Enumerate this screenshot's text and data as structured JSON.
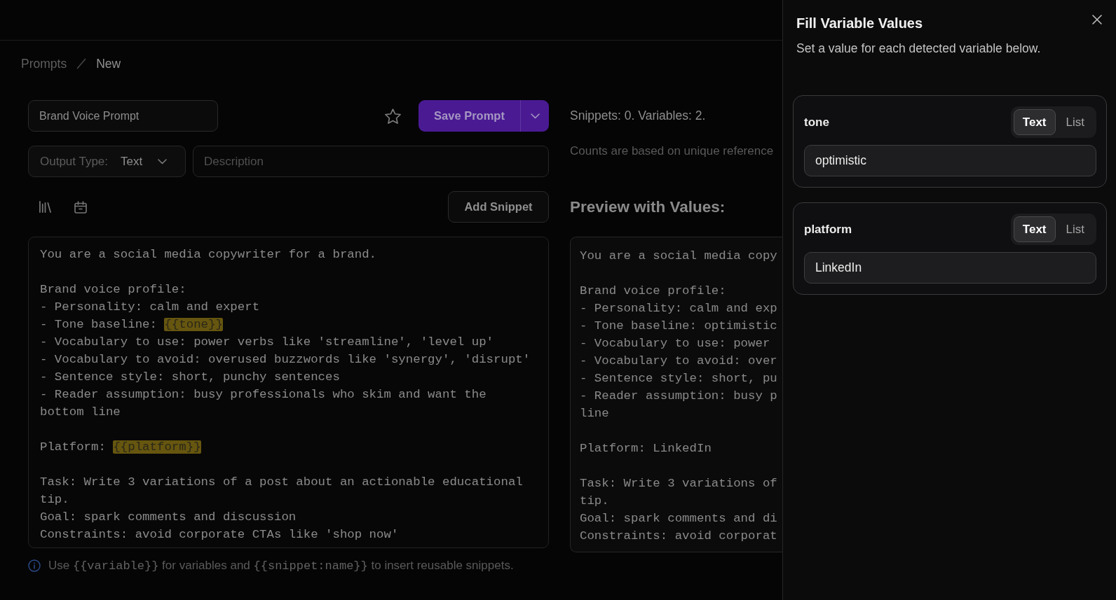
{
  "breadcrumb": [
    {
      "label": "Prompts",
      "current": false
    },
    {
      "label": "New",
      "current": true
    }
  ],
  "title_input": {
    "value": "Brand Voice Prompt"
  },
  "save_button": {
    "label": "Save Prompt"
  },
  "stats": "Snippets: 0. Variables: 2.",
  "output_type": {
    "label": "Output Type:",
    "value": "Text"
  },
  "description": {
    "placeholder": "Description"
  },
  "counts_note": "Counts are based on unique reference",
  "add_snippet_button": {
    "label": "Add Snippet"
  },
  "preview_heading": "Preview with Values:",
  "editor": {
    "paragraphs": [
      {
        "lines": [
          {
            "parts": [
              {
                "kind": "text",
                "text": "You are a social media copywriter for a brand."
              }
            ]
          }
        ]
      },
      {
        "lines": [
          {
            "parts": [
              {
                "kind": "text",
                "text": "Brand voice profile:"
              }
            ]
          },
          {
            "parts": [
              {
                "kind": "text",
                "text": "- Personality: calm and expert"
              }
            ]
          },
          {
            "parts": [
              {
                "kind": "text",
                "text": "- Tone baseline: "
              },
              {
                "kind": "variable",
                "text": "{{tone}}"
              }
            ]
          },
          {
            "parts": [
              {
                "kind": "text",
                "text": "- Vocabulary to use: power verbs like 'streamline', 'level up'"
              }
            ]
          },
          {
            "parts": [
              {
                "kind": "text",
                "text": "- Vocabulary to avoid: overused buzzwords like 'synergy', 'disrupt'"
              }
            ]
          },
          {
            "parts": [
              {
                "kind": "text",
                "text": "- Sentence style: short, punchy sentences"
              }
            ]
          },
          {
            "parts": [
              {
                "kind": "text",
                "text": "- Reader assumption: busy professionals who skim and want the bottom line"
              }
            ]
          }
        ]
      },
      {
        "lines": [
          {
            "parts": [
              {
                "kind": "text",
                "text": "Platform: "
              },
              {
                "kind": "variable",
                "text": "{{platform}}"
              }
            ]
          }
        ]
      },
      {
        "lines": [
          {
            "parts": [
              {
                "kind": "text",
                "text": "Task: Write 3 variations of a post about an actionable educational tip."
              }
            ]
          },
          {
            "parts": [
              {
                "kind": "text",
                "text": "Goal: spark comments and discussion"
              }
            ]
          },
          {
            "parts": [
              {
                "kind": "text",
                "text": "Constraints: avoid corporate CTAs like 'shop now'"
              }
            ]
          }
        ]
      }
    ]
  },
  "preview": {
    "paragraphs": [
      {
        "lines": [
          "You are a social media copy"
        ]
      },
      {
        "lines": [
          "Brand voice profile:",
          "- Personality: calm and exp",
          "- Tone baseline: optimistic",
          "- Vocabulary to use: power",
          "- Vocabulary to avoid: over",
          "- Sentence style: short, pu",
          "- Reader assumption: busy p",
          "line"
        ]
      },
      {
        "lines": [
          "Platform: LinkedIn"
        ]
      },
      {
        "lines": [
          "Task: Write 3 variations of",
          "tip.",
          "Goal: spark comments and di",
          "Constraints: avoid corporat"
        ]
      }
    ]
  },
  "hint": {
    "parts": [
      {
        "kind": "text",
        "text": "Use "
      },
      {
        "kind": "code",
        "text": "{{variable}}"
      },
      {
        "kind": "text",
        "text": " for variables and "
      },
      {
        "kind": "code",
        "text": "{{snippet:name}}"
      },
      {
        "kind": "text",
        "text": " to insert reusable snippets."
      }
    ]
  },
  "drawer": {
    "title": "Fill Variable Values",
    "subtitle": "Set a value for each detected variable below.",
    "variables": [
      {
        "name": "tone",
        "modes": [
          {
            "label": "Text",
            "selected": true
          },
          {
            "label": "List",
            "selected": false
          }
        ],
        "value": "optimistic"
      },
      {
        "name": "platform",
        "modes": [
          {
            "label": "Text",
            "selected": true
          },
          {
            "label": "List",
            "selected": false
          }
        ],
        "value": "LinkedIn"
      }
    ]
  }
}
